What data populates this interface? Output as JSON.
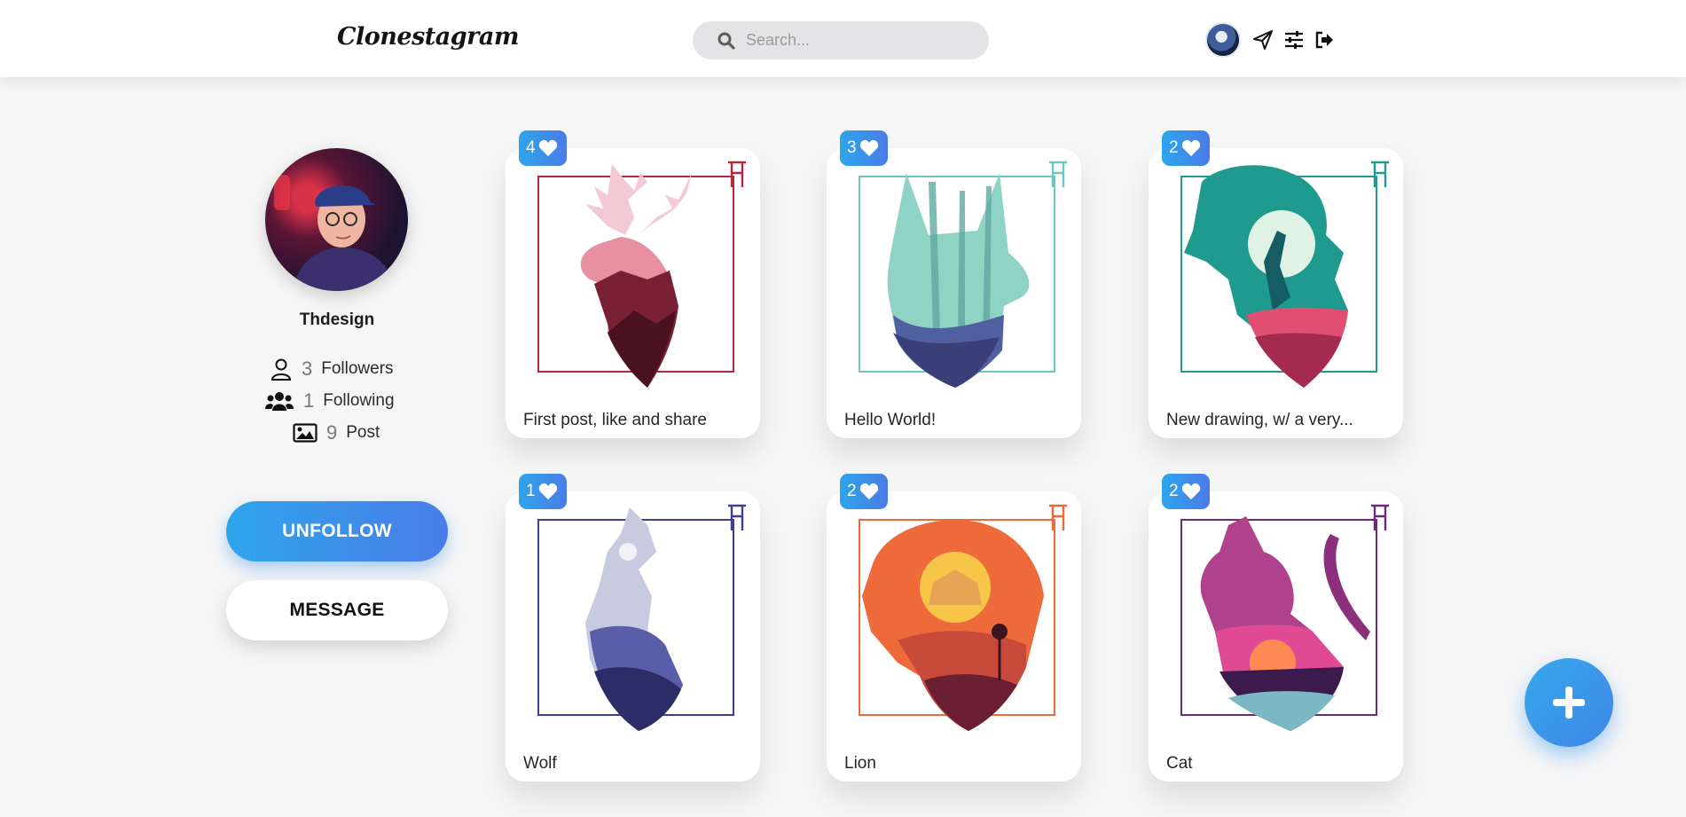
{
  "app": {
    "logo": "Clonestagram"
  },
  "search": {
    "placeholder": "Search..."
  },
  "profile": {
    "name": "Thdesign",
    "stats": [
      {
        "count": "3",
        "label": "Followers",
        "icon": "user-icon"
      },
      {
        "count": "1",
        "label": "Following",
        "icon": "users-icon"
      },
      {
        "count": "9",
        "label": "Post",
        "icon": "image-icon"
      }
    ],
    "unfollow_label": "UNFOLLOW",
    "message_label": "MESSAGE"
  },
  "posts": [
    {
      "likes": "4",
      "caption": "First post, like and share",
      "animal": "deer",
      "color": "#b6283f",
      "accent": "#f4c9d6"
    },
    {
      "likes": "3",
      "caption": "Hello World!",
      "animal": "dog",
      "color": "#6cc7bd",
      "accent": "#4f5fa0"
    },
    {
      "likes": "2",
      "caption": "New drawing, w/ a very...",
      "animal": "dinosaur",
      "color": "#1f9a8f",
      "accent": "#e04f72"
    },
    {
      "likes": "1",
      "caption": "Wolf",
      "animal": "wolf",
      "color": "#3d3f92",
      "accent": "#c8cbe0"
    },
    {
      "likes": "2",
      "caption": "Lion",
      "animal": "lion",
      "color": "#ef6a3a",
      "accent": "#f7c548"
    },
    {
      "likes": "2",
      "caption": "Cat",
      "animal": "cat",
      "color": "#6b2a7a",
      "accent": "#e04a93"
    }
  ]
}
